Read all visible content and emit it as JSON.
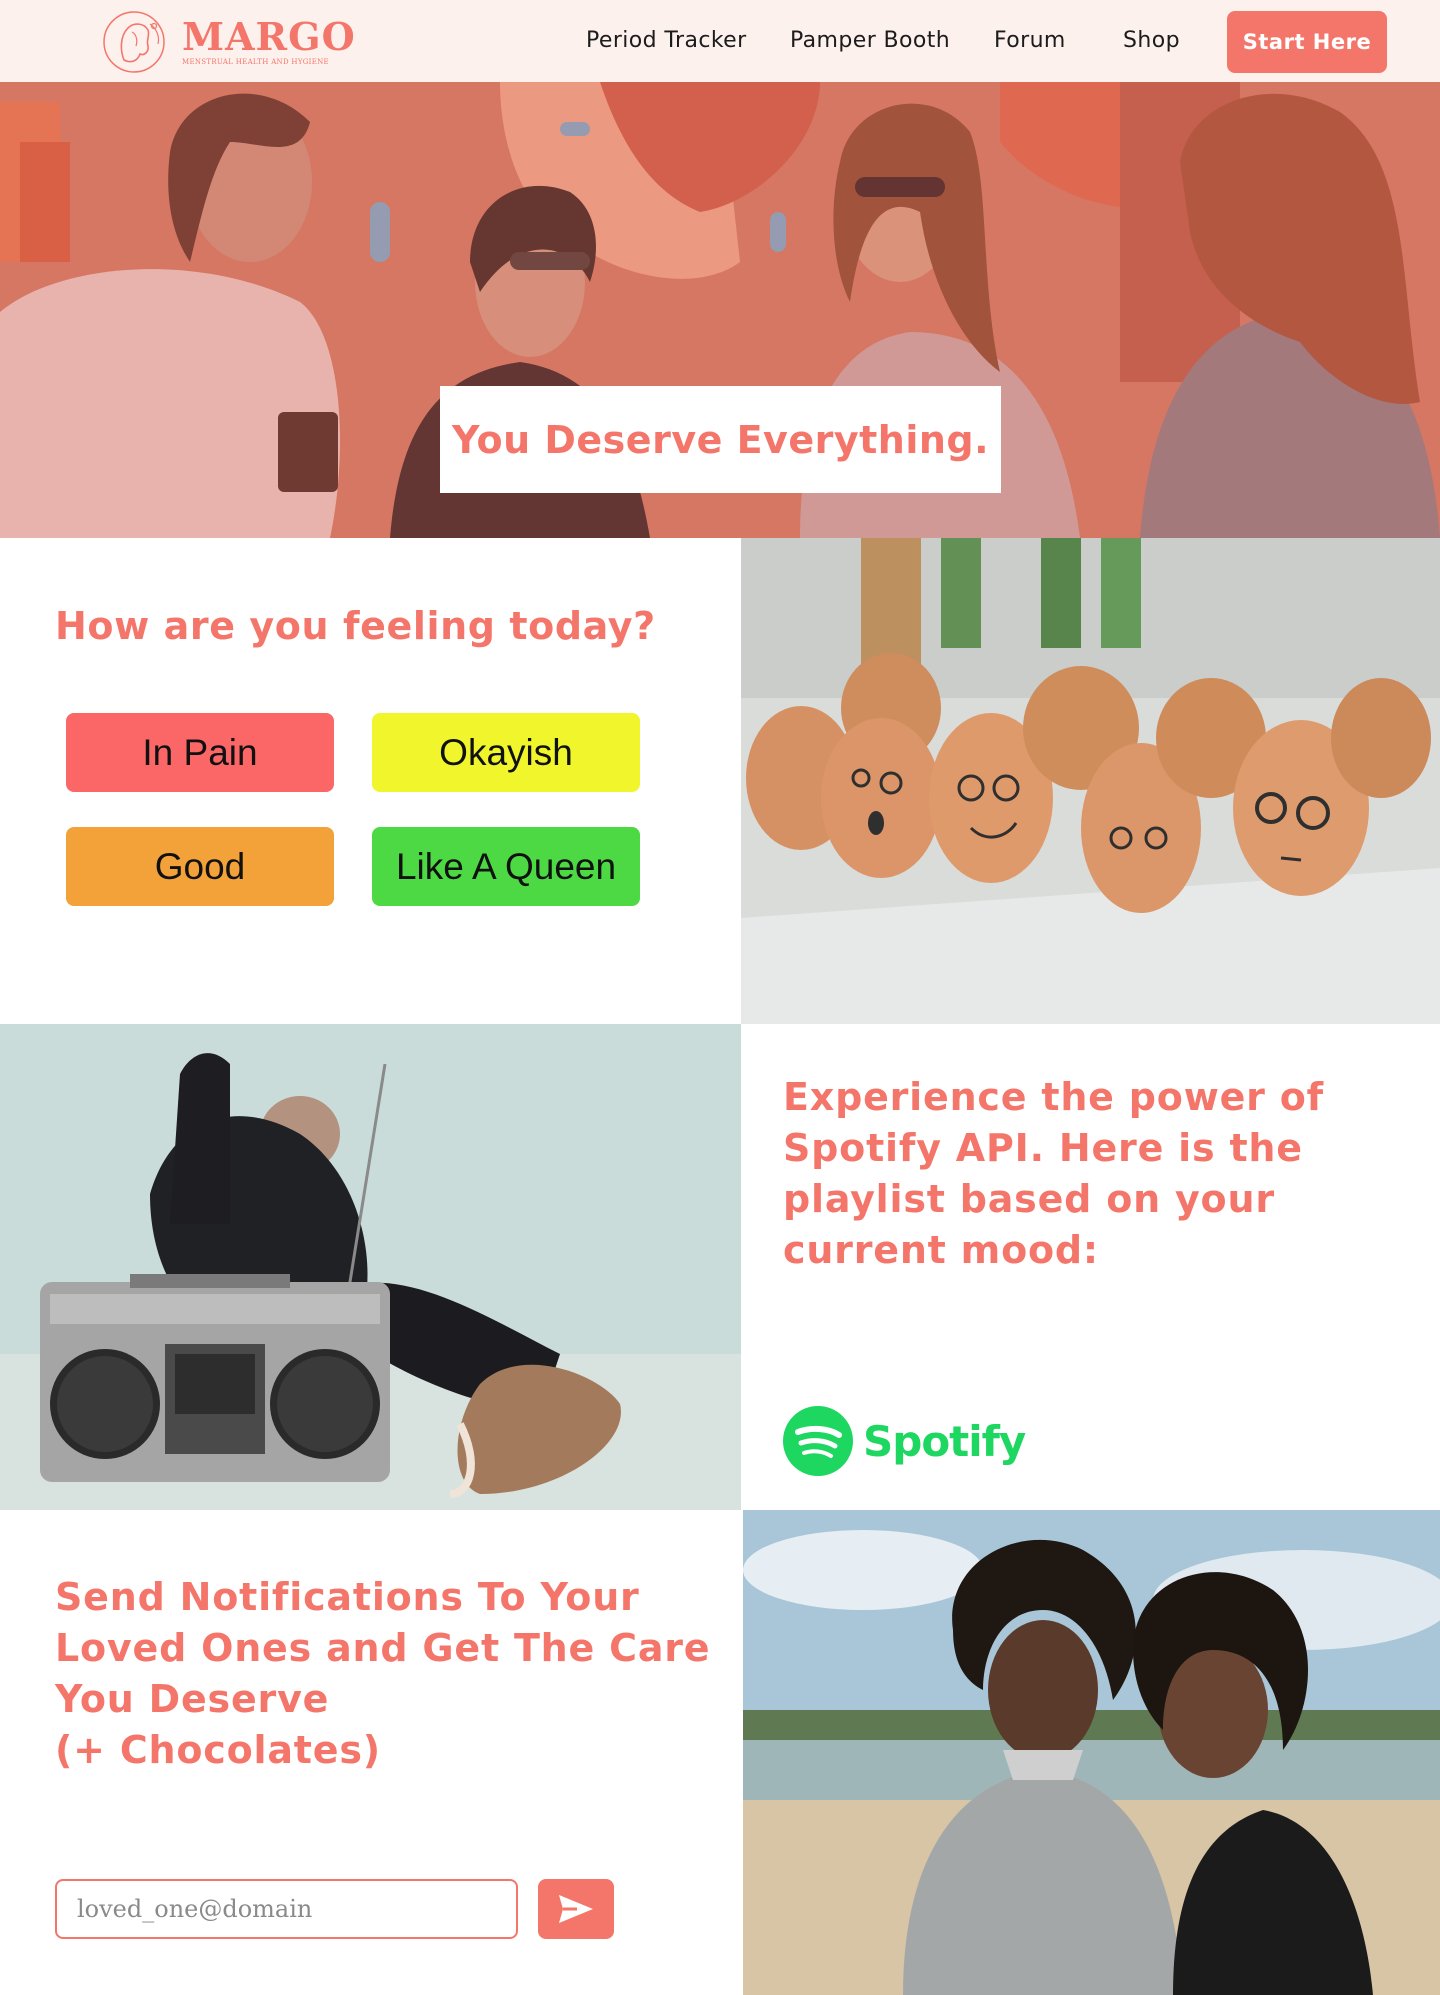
{
  "brand": {
    "name": "MARGO",
    "tagline": "MENSTRUAL HEALTH AND HYGIENE",
    "color": "#f4766a"
  },
  "nav": {
    "links": [
      "Period Tracker",
      "Pamper Booth",
      "Forum",
      "Shop"
    ],
    "cta": "Start Here"
  },
  "hero": {
    "headline": "You Deserve Everything."
  },
  "mood": {
    "title": "How are you feeling today?",
    "options": [
      {
        "label": "In Pain",
        "color": "#fb6666"
      },
      {
        "label": "Okayish",
        "color": "#f0f52c"
      },
      {
        "label": "Good",
        "color": "#f3a23a"
      },
      {
        "label": "Like A Queen",
        "color": "#4cd944"
      }
    ]
  },
  "spotify": {
    "text": "Experience the power of Spotify API. Here is the playlist based on your current mood:",
    "logo_word": "Spotify",
    "logo_color": "#1ed760"
  },
  "notify": {
    "text_lines": [
      "Send Notifications To Your",
      "Loved Ones and Get The Care",
      "You Deserve",
      "(+ Chocolates)"
    ],
    "email_placeholder": "loved_one@domain"
  }
}
